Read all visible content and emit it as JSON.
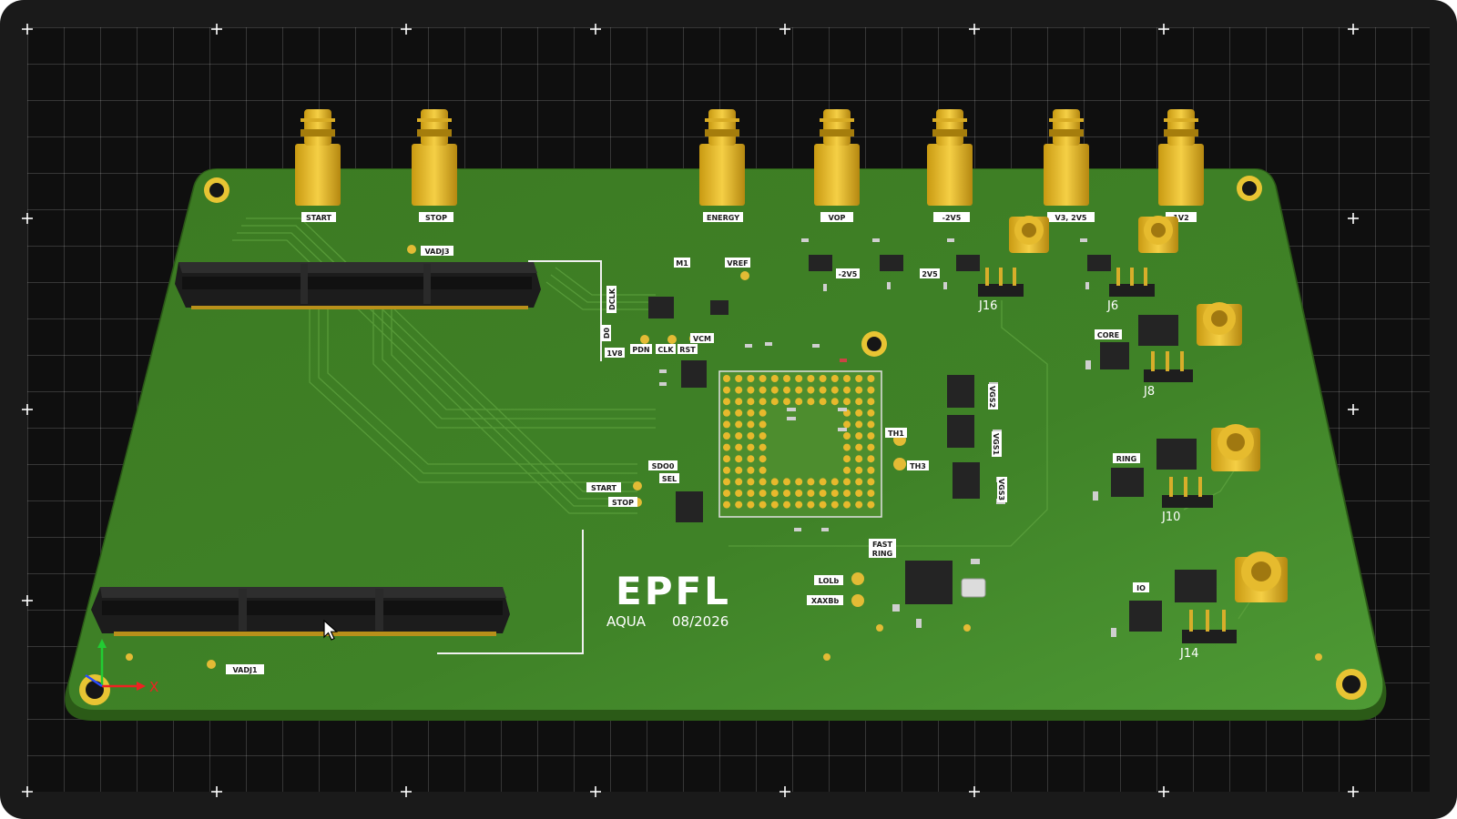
{
  "viewer": {
    "axes": {
      "x_label": "X"
    }
  },
  "board": {
    "connectors": [
      "START",
      "STOP",
      "ENERGY",
      "VOP",
      "-2V5",
      "V3, 2V5",
      "1V2"
    ],
    "headers": [
      "J16",
      "J6",
      "J8",
      "J10",
      "J14"
    ],
    "labels": {
      "vadj3": "VADJ3",
      "vadj1": "VADJ1",
      "dclk": "DCLK",
      "m1": "M1",
      "vref": "VREF",
      "d0": "D0",
      "v1v8": "1V8",
      "pdn": "PDN",
      "clk": "CLK",
      "rst": "RST",
      "vcm": "VCM",
      "neg2v5": "-2V5",
      "v2v5": "2V5",
      "core": "CORE",
      "ring": "RING",
      "io": "IO",
      "th1": "TH1",
      "th3": "TH3",
      "sdo0": "SDO0",
      "sel": "SEL",
      "start": "START",
      "stop": "STOP",
      "fast": "FAST",
      "ring2": "RING",
      "lolb": "LOLb",
      "xaxbb": "XAXBb",
      "vgs2": "VGS2",
      "vgs1": "VGS1",
      "vgs3": "VGS3"
    },
    "logo": "EPFL",
    "project": "AQUA",
    "date": "08/2026"
  }
}
